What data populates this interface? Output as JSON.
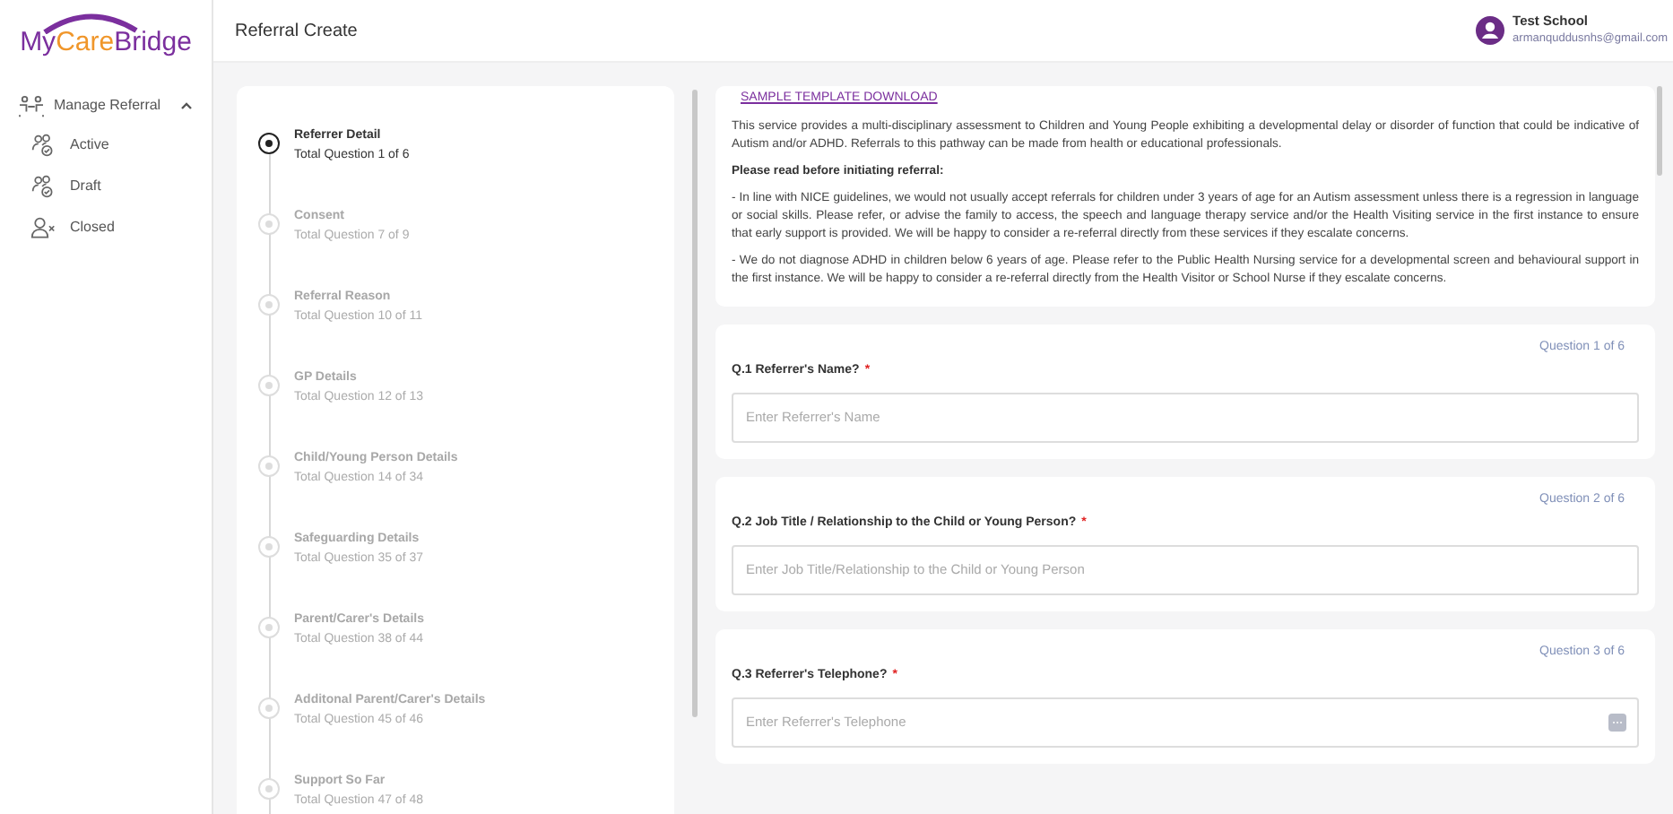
{
  "logo": {
    "parts": [
      {
        "text": "My",
        "color": "#7b2f9e"
      },
      {
        "text": "Care",
        "color": "#f0962a"
      },
      {
        "text": "Bridge",
        "color": "#7b2f9e"
      }
    ]
  },
  "sidebar": {
    "group": {
      "label": "Manage Referral",
      "expanded": true
    },
    "items": [
      {
        "label": "Active",
        "kind": "active"
      },
      {
        "label": "Draft",
        "kind": "draft"
      },
      {
        "label": "Closed",
        "kind": "closed"
      }
    ]
  },
  "header": {
    "title": "Referral Create",
    "user": {
      "name": "Test School",
      "email": "armanquddusnhs@gmail.com"
    }
  },
  "steps": [
    {
      "title": "Referrer Detail",
      "subtitle": "Total Question 1 of 6",
      "selected": true
    },
    {
      "title": "Consent",
      "subtitle": "Total Question 7 of 9",
      "selected": false
    },
    {
      "title": "Referral Reason",
      "subtitle": "Total Question 10 of 11",
      "selected": false
    },
    {
      "title": "GP Details",
      "subtitle": "Total Question 12 of 13",
      "selected": false
    },
    {
      "title": "Child/Young Person Details",
      "subtitle": "Total Question 14 of 34",
      "selected": false
    },
    {
      "title": "Safeguarding Details",
      "subtitle": "Total Question 35 of 37",
      "selected": false
    },
    {
      "title": "Parent/Carer's Details",
      "subtitle": "Total Question 38 of 44",
      "selected": false
    },
    {
      "title": "Additonal Parent/Carer's Details",
      "subtitle": "Total Question 45 of 46",
      "selected": false
    },
    {
      "title": "Support So Far",
      "subtitle": "Total Question 47 of 48",
      "selected": false
    }
  ],
  "info": {
    "link": "SAMPLE TEMPLATE DOWNLOAD",
    "intro": "This service provides a multi-disciplinary assessment to Children and Young People exhibiting a developmental delay or disorder of function that could be indicative of Autism and/or ADHD. Referrals to this pathway can be made from health or educational professionals.",
    "heading": "Please read before initiating referral:",
    "notes": [
      "- In line with NICE guidelines, we would not usually accept referrals for children under 3 years of age for an Autism assessment unless there is a regression in language or social skills. Please refer, or advise the family to access, the speech and language therapy service and/or the Health Visiting service in the first instance to ensure that early support is provided. We will be happy to consider a re-referral directly from these services if they escalate concerns.",
      "- We do not diagnose ADHD in children below 6 years of age. Please refer to the Public Health Nursing service for a developmental screen and behavioural support in the first instance. We will be happy to consider a re-referral directly from the Health Visitor or School Nurse if they escalate concerns."
    ]
  },
  "questions": [
    {
      "counter": "Question 1 of 6",
      "label": "Q.1 Referrer's Name?",
      "required_mark": "*",
      "placeholder": "Enter Referrer's Name",
      "kind": "text"
    },
    {
      "counter": "Question 2 of 6",
      "label": "Q.2 Job Title / Relationship to the Child or Young Person?",
      "required_mark": "*",
      "placeholder": "Enter Job Title/Relationship to the Child or Young Person",
      "kind": "text"
    },
    {
      "counter": "Question 3 of 6",
      "label": "Q.3 Referrer's Telephone?",
      "required_mark": "*",
      "placeholder": "Enter Referrer's Telephone",
      "kind": "phone"
    }
  ]
}
